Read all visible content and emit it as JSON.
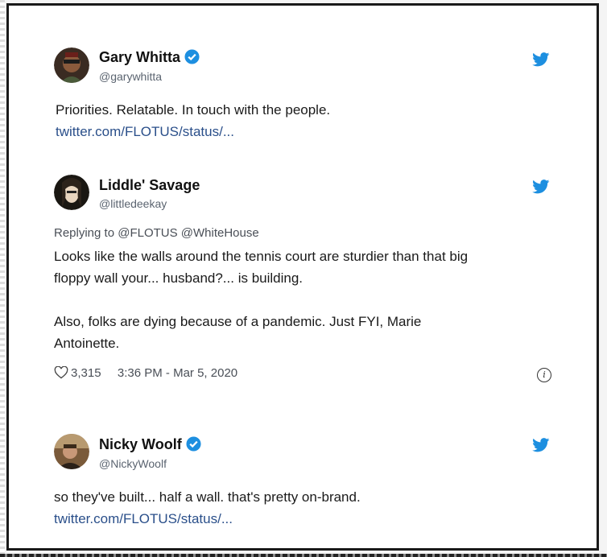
{
  "colors": {
    "twitter_blue": "#1d8fe0",
    "link": "#2a4f8a"
  },
  "tweets": [
    {
      "name": "Gary Whitta",
      "verified": true,
      "handle": "@garywhitta",
      "text": "Priorities. Relatable. In touch with the people.",
      "link": "twitter.com/FLOTUS/status/..."
    },
    {
      "name": "Liddle' Savage",
      "verified": false,
      "handle": "@littledeekay",
      "reply": "Replying to @FLOTUS @WhiteHouse",
      "text_line1": "Looks like the walls around the tennis court are sturdier than that big",
      "text_line2": "floppy wall your... husband?... is building.",
      "text_line3": "Also, folks are dying because of a pandemic. Just FYI, Marie",
      "text_line4": "Antoinette.",
      "likes": "3,315",
      "timestamp": "3:36 PM - Mar 5, 2020"
    },
    {
      "name": "Nicky Woolf",
      "verified": true,
      "handle": "@NickyWoolf",
      "text": "so they've built... half a wall. that's pretty on-brand.",
      "link": "twitter.com/FLOTUS/status/..."
    }
  ]
}
